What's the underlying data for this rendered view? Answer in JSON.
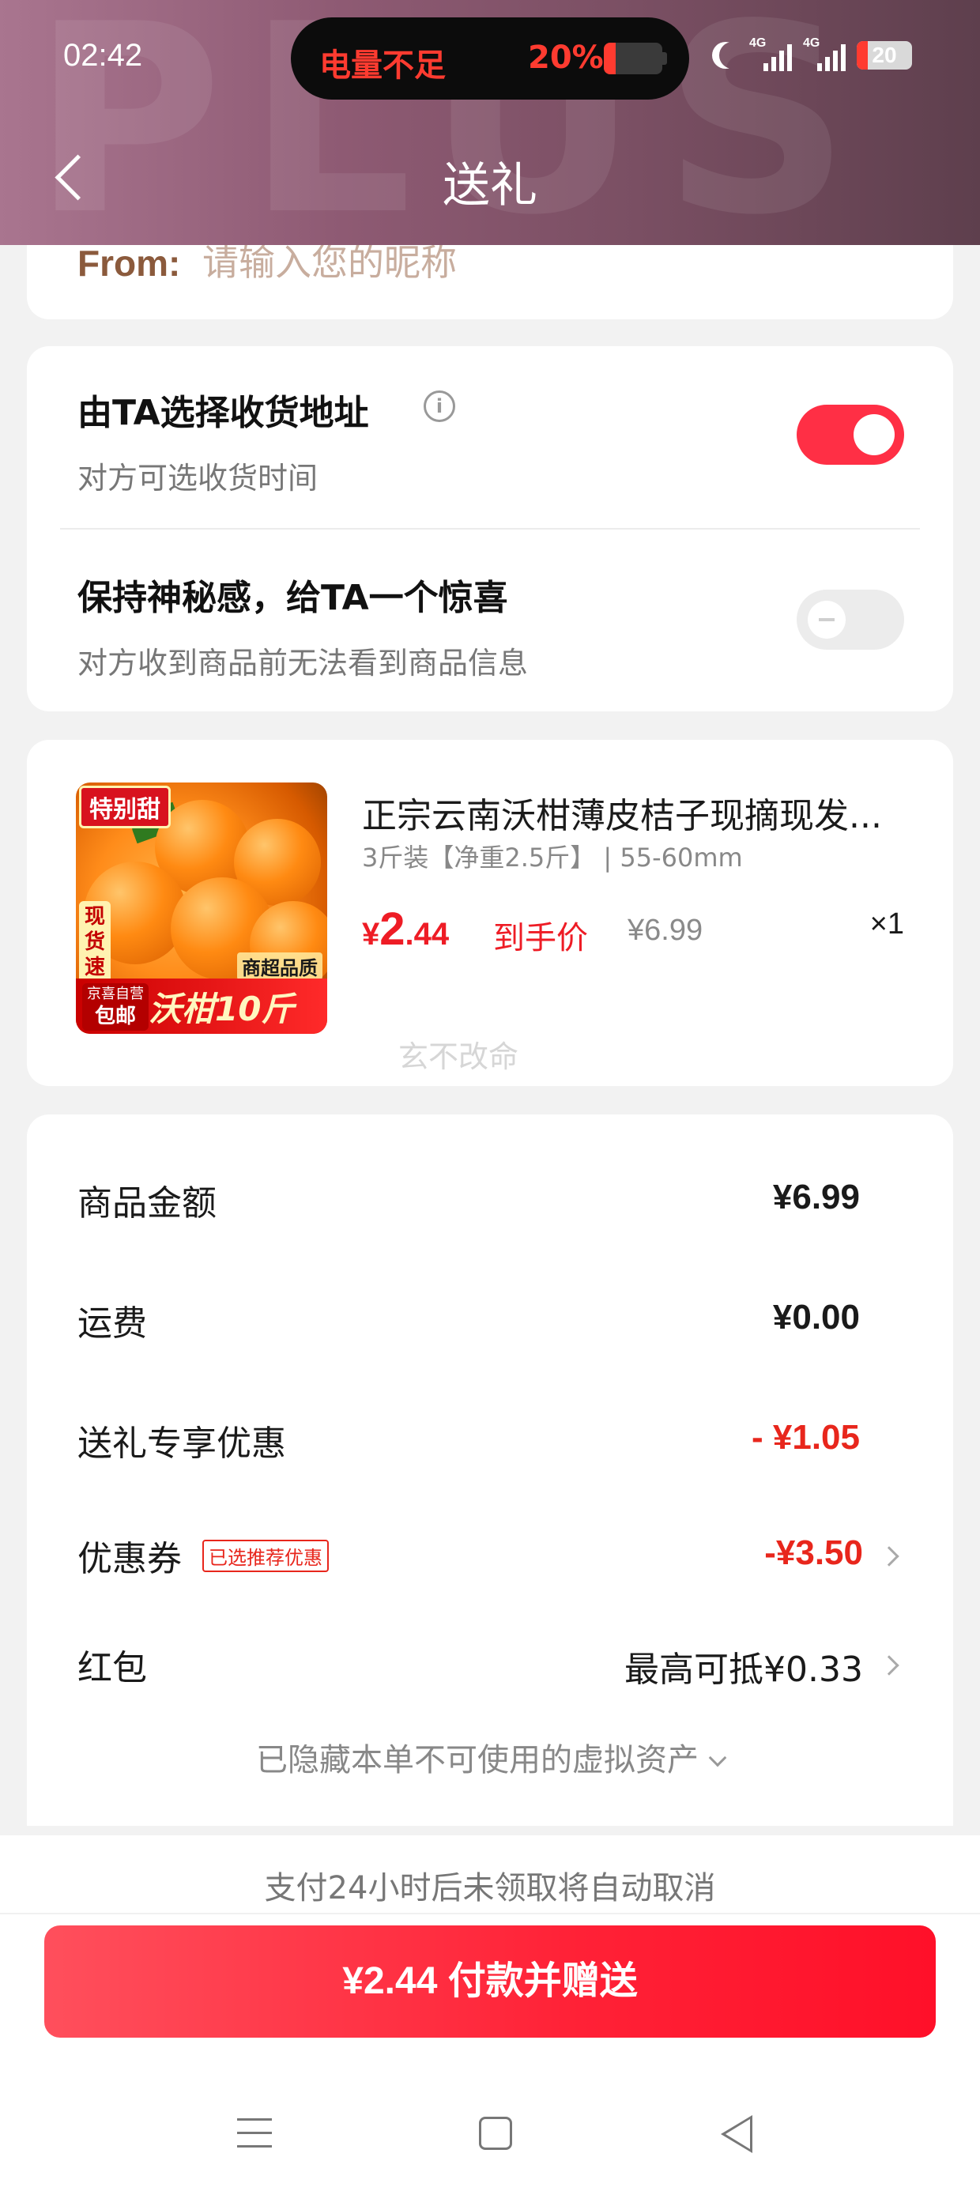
{
  "status_bar": {
    "time": "02:42",
    "island_text": "电量不足",
    "island_percent": "20%",
    "network_1": "4G",
    "network_2": "4G",
    "battery_level": "20",
    "alert_color": "#ff3b30"
  },
  "header": {
    "title": "送礼",
    "watermark": "PLUS",
    "back_icon": "chevron-left-icon"
  },
  "from_section": {
    "label": "From:",
    "placeholder": "请输入您的昵称",
    "value": ""
  },
  "options": {
    "address": {
      "title": "由TA选择收货地址",
      "subtitle": "对方可选收货时间",
      "info_icon": "i",
      "enabled": true
    },
    "mystery": {
      "title": "保持神秘感，给TA一个惊喜",
      "subtitle": "对方收到商品前无法看到商品信息",
      "enabled": false
    }
  },
  "product": {
    "title": "正宗云南沃柑薄皮桔子现摘现发...",
    "spec": "3斤装【净重2.5斤】 | 55-60mm",
    "price_symbol": "¥",
    "price_int": "2",
    "price_dec": ".44",
    "price_tag": "到手价",
    "original_price": "¥6.99",
    "quantity": "×1",
    "image_badge": "特别甜",
    "image_side": "现货速发",
    "image_self_op": "京喜自营",
    "image_free_ship": "包邮",
    "image_banner": "沃柑10斤",
    "image_quality": "商超品质",
    "overlay_watermark": "玄不改命"
  },
  "summary": {
    "rows": [
      {
        "label": "商品金额",
        "value": "¥6.99"
      },
      {
        "label": "运费",
        "value": "¥0.00"
      },
      {
        "label": "送礼专享优惠",
        "value": "- ¥1.05"
      },
      {
        "label": "优惠券",
        "tag": "已选推荐优惠",
        "value": "-¥3.50"
      },
      {
        "label": "红包",
        "value": "最高可抵¥0.33"
      }
    ],
    "hidden_assets": "已隐藏本单不可使用的虚拟资产"
  },
  "footer": {
    "notice": "支付24小时后未领取将自动取消",
    "pay_button": "¥2.44 付款并赠送",
    "accent": "#ff2136"
  },
  "nav": {
    "menu_icon": "menu-icon",
    "home_icon": "home-icon",
    "back_icon": "back-triangle-icon"
  }
}
